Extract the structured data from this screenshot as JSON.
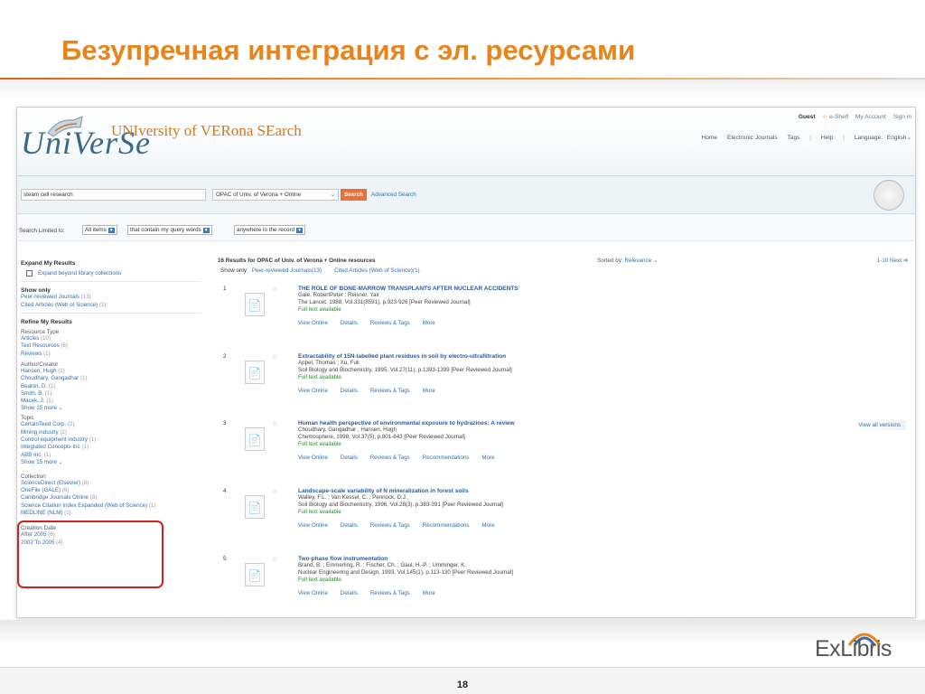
{
  "slide": {
    "title": "Безупречная интеграция с эл. ресурсами",
    "page_number": "18",
    "brand": "ExLibris"
  },
  "header": {
    "logo_main": "UniVerSe",
    "logo_line": "UNIversity of VERona SEarch",
    "top_links": [
      "Guest",
      "e-Shelf",
      "My Account",
      "Sign in"
    ],
    "nav_links": [
      "Home",
      "Electronic Journals",
      "Tags",
      "Help",
      "Language:",
      "English"
    ]
  },
  "search": {
    "query": "steam cell research",
    "scope": "OPAC of Univ. of Verona + Online",
    "button": "Search",
    "advanced": "Advanced Search"
  },
  "limit": {
    "label": "Search Limited to:",
    "options": [
      "All items",
      "that contain my query words",
      "anywhere in the record"
    ]
  },
  "facets": {
    "expand_heading": "Expand My Results",
    "expand_option": "Expand beyond library collections",
    "show_only_heading": "Show only",
    "show_only": [
      {
        "label": "Peer-reviewed Journals",
        "count": "(13)"
      },
      {
        "label": "Cited Articles (Web of Science)",
        "count": "(1)"
      }
    ],
    "refine_heading": "Refine My Results",
    "resource_type_heading": "Resource Type",
    "resource_type": [
      {
        "label": "Articles",
        "count": "(10)"
      },
      {
        "label": "Text Resources",
        "count": "(6)"
      },
      {
        "label": "Reviews",
        "count": "(1)"
      }
    ],
    "author_heading": "Author/Creator",
    "authors": [
      {
        "label": "Hansen, Hugh",
        "count": "(1)"
      },
      {
        "label": "Choudhary, Gangadhar",
        "count": "(1)"
      },
      {
        "label": "Beaton, D.",
        "count": "(1)"
      },
      {
        "label": "Smith, B.",
        "count": "(1)"
      },
      {
        "label": "Macek, J.",
        "count": "(1)"
      }
    ],
    "author_more": "Show 15 more",
    "topic_heading": "Topic",
    "topics": [
      {
        "label": "CertainTeed Corp.",
        "count": "(2)"
      },
      {
        "label": "Mining industry",
        "count": "(2)"
      },
      {
        "label": "Control equipment industry",
        "count": "(1)"
      },
      {
        "label": "Integrated Concepts Inc",
        "count": "(1)"
      },
      {
        "label": "ABB Inc.",
        "count": "(1)"
      }
    ],
    "topic_more": "Show 15 more",
    "collection_heading": "Collection",
    "collections": [
      {
        "label": "ScienceDirect (Elsevier)",
        "count": "(8)"
      },
      {
        "label": "OneFile (GALE)",
        "count": "(6)"
      },
      {
        "label": "Cambridge Journals Online",
        "count": "(3)"
      },
      {
        "label": "Science Citation Index Expanded (Web of Science)",
        "count": "(1)"
      },
      {
        "label": "MEDLINE (NLM)",
        "count": "(1)"
      }
    ],
    "creation_heading": "Creation Date",
    "creation": [
      {
        "label": "After 2005",
        "count": "(6)"
      },
      {
        "label": "2002 To 2005",
        "count": "(4)"
      }
    ]
  },
  "results": {
    "count_text": "16 Results for",
    "scope_text": "OPAC of Univ. of Verona + Online resources",
    "show_only_label": "Show only:",
    "show_only_links": [
      "Peer-reviewed Journals(13)",
      "Cited Articles (Web of Science)(1)"
    ],
    "sorted_label": "Sorted by:",
    "sorted_value": "Relevance",
    "pager": "1-10 Next",
    "view_all": "View all versions",
    "records": [
      {
        "num": "1",
        "title": "THE ROLE OF BONE-MARROW TRANSPLANTS AFTER NUCLEAR ACCIDENTS",
        "authors": "Gale, RobertPeter ; Reisner, Yair",
        "source": "The Lancet, 1988, Vol.331(8591), p.923-926 [Peer Reviewed Journal]",
        "fulltext": "Full text available",
        "tabs": [
          "View Online",
          "Details",
          "Reviews & Tags",
          "More"
        ]
      },
      {
        "num": "2",
        "title": "Extractability of 15N-labelled plant residues in soil by electro-ultrafiltration",
        "authors": "Appel, Thomas ; Xu, Fuli",
        "source": "Soil Biology and Biochemistry, 1995, Vol.27(11), p.1393-1399 [Peer Reviewed Journal]",
        "fulltext": "Full text available",
        "tabs": [
          "View Online",
          "Details",
          "Reviews & Tags",
          "More"
        ]
      },
      {
        "num": "3",
        "title": "Human health perspective of environmental exposure to hydrazines: A review",
        "authors": "Choudhary, Gangadhar ; Hansen, Hugh",
        "source": "Chemosphere, 1998, Vol.37(5), p.801-843 [Peer Reviewed Journal]",
        "fulltext": "Full text available",
        "tabs": [
          "View Online",
          "Details",
          "Reviews & Tags",
          "Recommendations",
          "More"
        ]
      },
      {
        "num": "4",
        "title": "Landscape-scale variability of N mineralization in forest soils",
        "authors": "Walley, F.L. ; Van Kessel, C. ; Pennock, D.J.",
        "source": "Soil Biology and Biochemistry, 1996, Vol.28(3), p.383-391 [Peer Reviewed Journal]",
        "fulltext": "Full text available",
        "tabs": [
          "View Online",
          "Details",
          "Reviews & Tags",
          "Recommendations",
          "More"
        ]
      },
      {
        "num": "5",
        "title": "Two-phase flow instrumentation",
        "authors": "Brand, B. ; Emmerling, R. ; Fischer, Ch. ; Gaul, H.-P. ; Umminger, K.",
        "source": "Nuclear Engineering and Design, 1993, Vol.145(1), p.113-130 [Peer Reviewed Journal]",
        "fulltext": "Full text available",
        "tabs": [
          "View Online",
          "Details",
          "Reviews & Tags",
          "More"
        ]
      }
    ]
  },
  "colors": {
    "title": "#e8841a",
    "link": "#3070b0",
    "search_button": "#e8703a",
    "highlight_box": "#d42020",
    "fulltext": "#2a8a2a"
  }
}
